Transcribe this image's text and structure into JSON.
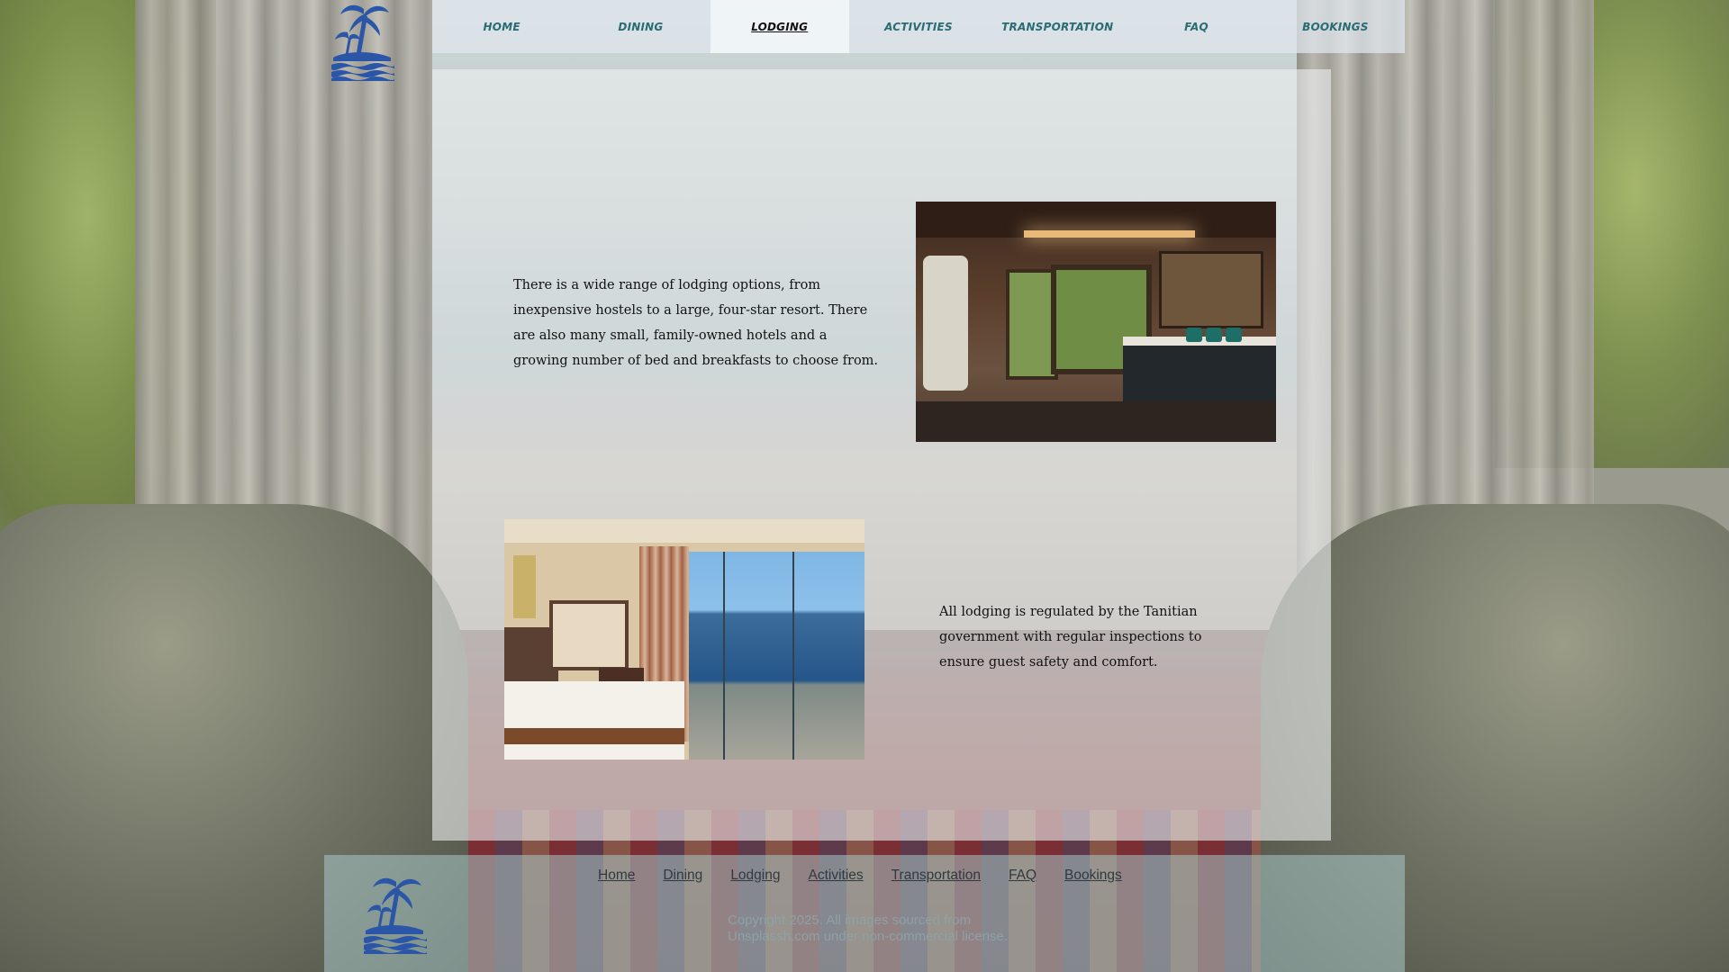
{
  "nav": {
    "items": [
      {
        "label": "Home"
      },
      {
        "label": "Dining"
      },
      {
        "label": "Lodging"
      },
      {
        "label": "Activities"
      },
      {
        "label": "Transportation"
      },
      {
        "label": "FAQ"
      },
      {
        "label": "Bookings"
      }
    ],
    "active_index": 2
  },
  "content": {
    "section1_text": "There is a wide range of lodging options, from inexpensive hostels to a large, four-star resort. There are also many small, family-owned hotels and a growing number of bed and breakfasts to choose from.",
    "section2_text": "All lodging is regulated by the Tanitian government with regular inspections to ensure guest safety and comfort."
  },
  "footer": {
    "links": [
      {
        "label": "Home"
      },
      {
        "label": "Dining"
      },
      {
        "label": "Lodging"
      },
      {
        "label": "Activities"
      },
      {
        "label": "Transportation"
      },
      {
        "label": "FAQ"
      },
      {
        "label": "Bookings"
      }
    ],
    "copyright": "Copyright 2025. All images sourced from Unsplassh.com under non-commercial license."
  },
  "icons": {
    "logo": "palm-island-logo-icon"
  },
  "colors": {
    "nav_text": "#2a6c74",
    "logo_blue": "#2b56a8",
    "footer_bg": "#aac8c8"
  }
}
